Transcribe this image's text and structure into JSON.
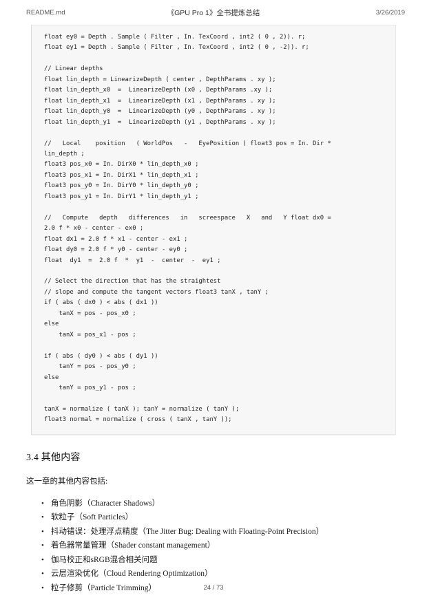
{
  "header": {
    "left": "README.md",
    "center": "《GPU Pro 1》全书提炼总结",
    "right": "3/26/2019"
  },
  "code_block": {
    "language": "hlsl",
    "text": "float ey0 = Depth . Sample ( Filter , In. TexCoord , int2 ( 0 , 2)). r;\nfloat ey1 = Depth . Sample ( Filter , In. TexCoord , int2 ( 0 , -2)). r;\n\n// Linear depths\nfloat lin_depth = LinearizeDepth ( center , DepthParams . xy );\nfloat lin_depth_x0  =  LinearizeDepth (x0 , DepthParams .xy );\nfloat lin_depth_x1  =  LinearizeDepth (x1 , DepthParams . xy );\nfloat lin_depth_y0  =  LinearizeDepth (y0 , DepthParams . xy );\nfloat lin_depth_y1  =  LinearizeDepth (y1 , DepthParams . xy );\n\n//   Local    position   ( WorldPos   -   EyePosition ) float3 pos = In. Dir *\nlin_depth ;\nfloat3 pos_x0 = In. DirX0 * lin_depth_x0 ;\nfloat3 pos_x1 = In. DirX1 * lin_depth_x1 ;\nfloat3 pos_y0 = In. DirY0 * lin_depth_y0 ;\nfloat3 pos_y1 = In. DirY1 * lin_depth_y1 ;\n\n//   Compute   depth   differences   in   screespace   X   and   Y float dx0 =\n2.0 f * x0 - center - ex0 ;\nfloat dx1 = 2.0 f * x1 - center - ex1 ;\nfloat dy0 = 2.0 f * y0 - center - ey0 ;\nfloat  dy1  =  2.0 f  *  y1  -  center  -  ey1 ;\n\n// Select the direction that has the straightest\n// slope and compute the tangent vectors float3 tanX , tanY ;\nif ( abs ( dx0 ) < abs ( dx1 ))\n    tanX = pos - pos_x0 ;\nelse\n    tanX = pos_x1 - pos ;\n\nif ( abs ( dy0 ) < abs ( dy1 ))\n    tanY = pos - pos_y0 ;\nelse\n    tanY = pos_y1 - pos ;\n\ntanX = normalize ( tanX ); tanY = normalize ( tanY );\nfloat3 normal = normalize ( cross ( tanX , tanY ));"
  },
  "section": {
    "heading": "3.4 其他内容",
    "intro": "这一章的其他内容包括:",
    "items": [
      "角色阴影（Character Shadows）",
      "软粒子（Soft Particles）",
      "抖动错误：处理浮点精度（The Jitter Bug: Dealing with Floating-Point Precision）",
      "着色器常量管理（Shader constant management）",
      "伽马校正和sRGB混合相关问题",
      "云层渲染优化（Cloud Rendering Optimization）",
      "粒子修剪（Particle Trimming）"
    ]
  },
  "footer": {
    "page_indicator": "24 / 73"
  }
}
